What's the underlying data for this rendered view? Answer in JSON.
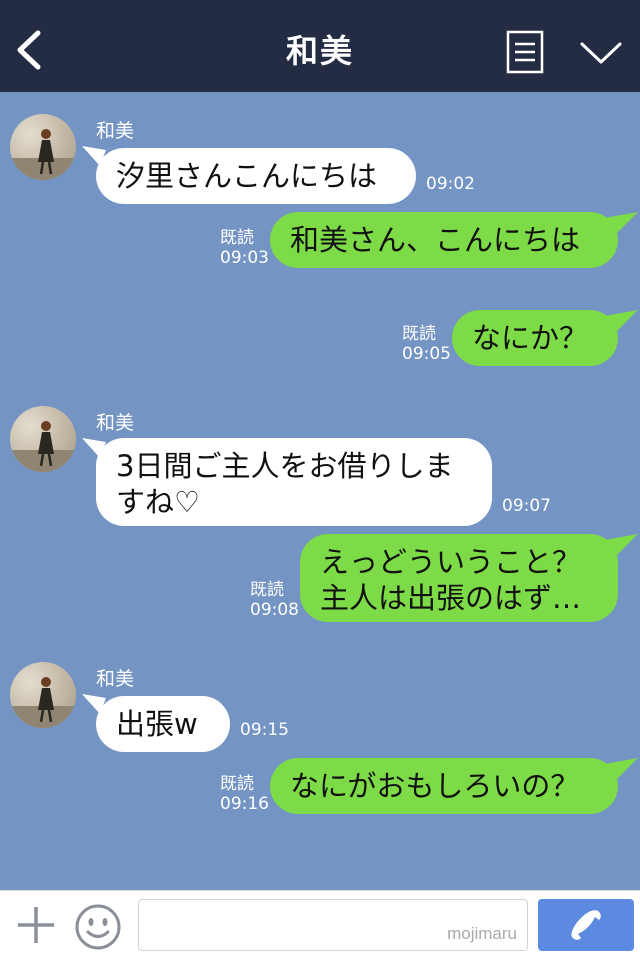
{
  "header": {
    "title": "和美"
  },
  "chat": {
    "messages": [
      {
        "side": "in",
        "sender": "和美",
        "text": "汐里さんこんにちは",
        "time": "09:02"
      },
      {
        "side": "out",
        "read": "既読",
        "text": "和美さん、こんにちは",
        "time": "09:03"
      },
      {
        "side": "out",
        "read": "既読",
        "text": "なにか？",
        "time": "09:05"
      },
      {
        "side": "in",
        "sender": "和美",
        "line1": "3日間ご主人をお借りしま",
        "line2": "すね♡",
        "time": "09:07"
      },
      {
        "side": "out",
        "read": "既読",
        "line1": "えっどういうこと？",
        "line2": "主人は出張のはず…",
        "time": "09:08"
      },
      {
        "side": "in",
        "sender": "和美",
        "text": "出張w",
        "time": "09:15"
      },
      {
        "side": "out",
        "read": "既読",
        "text": "なにがおもしろいの？",
        "time": "09:16"
      }
    ]
  },
  "input_bar": {
    "watermark": "mojimaru"
  },
  "colors": {
    "header_bg": "#232c43",
    "chat_bg": "#7494c3",
    "incoming_bubble": "#ffffff",
    "outgoing_bubble": "#7edb48",
    "call_button": "#5b8ae0"
  },
  "icons": [
    "back-icon",
    "menu-icon",
    "chevron-down-icon",
    "plus-icon",
    "emoji-icon",
    "phone-icon"
  ]
}
